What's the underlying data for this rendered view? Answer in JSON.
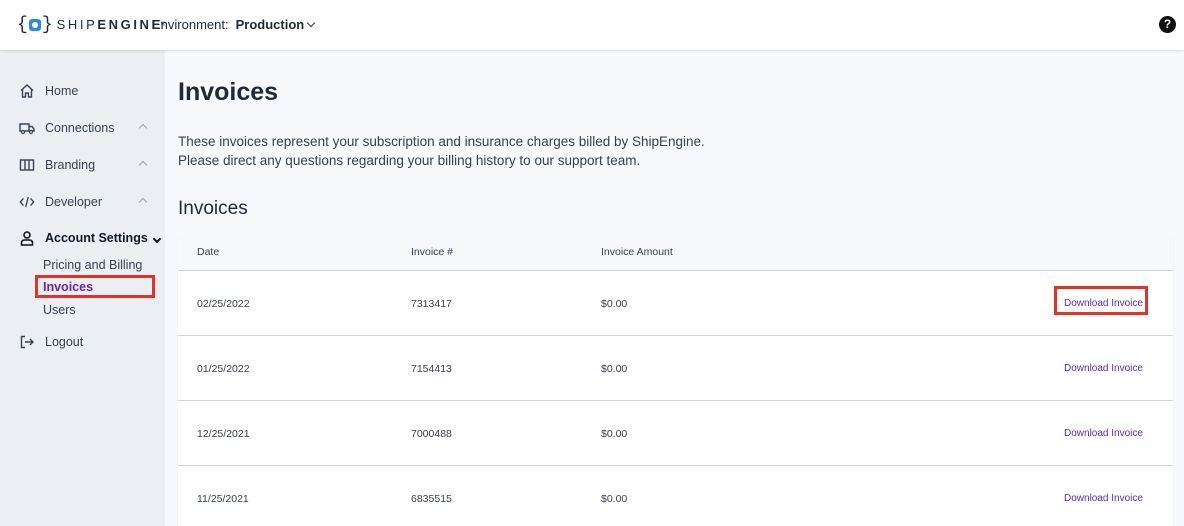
{
  "header": {
    "brand_prefix": "SHIP",
    "brand_suffix": "ENGINE",
    "env_label": "Environment:",
    "env_value": "Production",
    "help_symbol": "?"
  },
  "sidebar": {
    "items": [
      {
        "label": "Home",
        "icon": "home-icon"
      },
      {
        "label": "Connections",
        "icon": "truck-icon"
      },
      {
        "label": "Branding",
        "icon": "columns-icon"
      },
      {
        "label": "Developer",
        "icon": "code-icon"
      },
      {
        "label": "Account Settings",
        "icon": "user-icon"
      },
      {
        "label": "Logout",
        "icon": "logout-icon"
      }
    ],
    "sub_items": [
      "Pricing and Billing",
      "Invoices",
      "Users"
    ],
    "active_sub_item": "Invoices"
  },
  "main": {
    "title": "Invoices",
    "description_line1": "These invoices represent your subscription and insurance charges billed by ShipEngine.",
    "description_line2": "Please direct any questions regarding your billing history to our support team.",
    "section_title": "Invoices",
    "table": {
      "headers": [
        "Date",
        "Invoice #",
        "Invoice Amount"
      ],
      "rows": [
        {
          "date": "02/25/2022",
          "invoice": "7313417",
          "amount": "$0.00",
          "action": "Download Invoice"
        },
        {
          "date": "01/25/2022",
          "invoice": "7154413",
          "amount": "$0.00",
          "action": "Download Invoice"
        },
        {
          "date": "12/25/2021",
          "invoice": "7000488",
          "amount": "$0.00",
          "action": "Download Invoice"
        },
        {
          "date": "11/25/2021",
          "invoice": "6835515",
          "amount": "$0.00",
          "action": "Download Invoice"
        }
      ]
    }
  },
  "colors": {
    "accent": "#5b2bb5",
    "highlight": "#e0342a",
    "sidebar_bg": "#ebeef3",
    "logo_blue": "#2e8ae6"
  }
}
